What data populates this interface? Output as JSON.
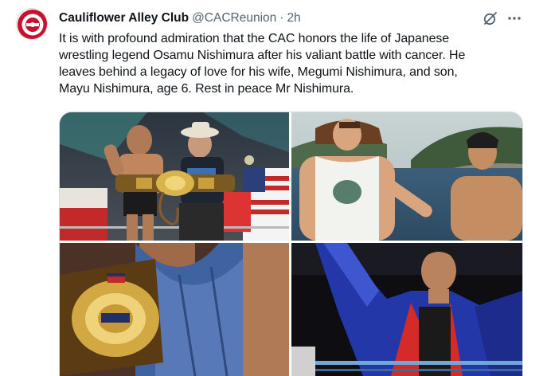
{
  "tweet": {
    "author_name": "Cauliflower Alley Club",
    "handle": "@CACReunion",
    "separator": "·",
    "time": "2h",
    "text_lines": [
      "It is with profound admiration that the CAC honors the life of Japanese",
      "wrestling legend Osamu Nishimura after his valiant battle with cancer. He",
      "leaves behind a legacy of love for his wife, Megumi Nishimura, and son,",
      "Mayu Nishimura, age 6. Rest in peace Mr Nishimura."
    ],
    "avatar_icon": "cauliflower-alley-club-logo",
    "actions": {
      "grok_icon": "grok-icon",
      "more_icon": "more-dots-icon"
    },
    "accent_color": "#536471"
  },
  "media": [
    {
      "icon": "photo-wrestler-with-championship-belt"
    },
    {
      "icon": "photo-two-men-by-sea"
    },
    {
      "icon": "photo-championship-belt-closeup"
    },
    {
      "icon": "photo-wrestler-in-robe-at-ring"
    }
  ]
}
